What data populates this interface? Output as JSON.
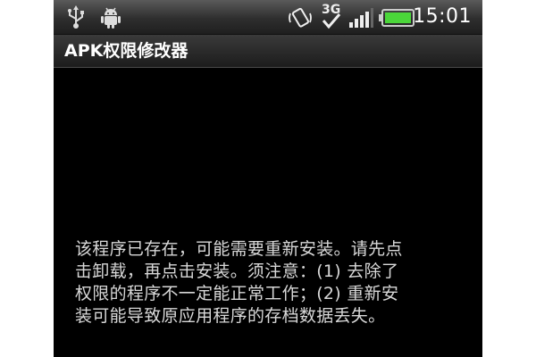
{
  "status_bar": {
    "icons": [
      "usb-icon",
      "android-debug-icon",
      "vibrate-icon",
      "network-3g-icon",
      "signal-icon",
      "battery-icon"
    ],
    "network_label": "3G",
    "battery_color": "#4bd63a",
    "time": "15:01"
  },
  "title_bar": {
    "title": "APK权限修改器"
  },
  "dialog": {
    "message": "该程序已存在，可能需要重新安装。请先点\n击卸载，再点击安装。须注意：(1) 去除了\n权限的程序不一定能正常工作；(2) 重新安\n装可能导致原应用程序的存档数据丢失。"
  }
}
